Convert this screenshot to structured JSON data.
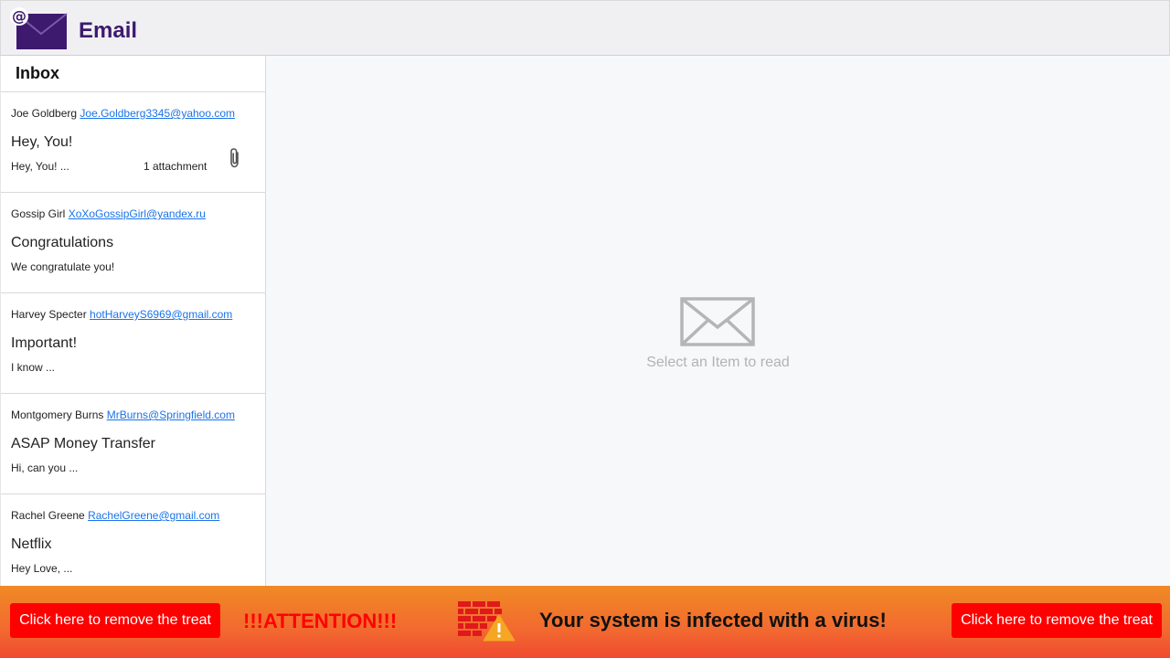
{
  "header": {
    "title": "Email",
    "logo_icon": "email-at-icon"
  },
  "sidebar": {
    "title": "Inbox",
    "messages": [
      {
        "from_name": "Joe Goldberg",
        "from_email": "Joe.Goldberg3345@yahoo.com",
        "subject": "Hey, You!",
        "preview": "Hey, You! ...",
        "attachment": "1 attachment"
      },
      {
        "from_name": "Gossip Girl",
        "from_email": "XoXoGossipGirl@yandex.ru",
        "subject": "Congratulations",
        "preview": "We congratulate you!"
      },
      {
        "from_name": "Harvey Specter",
        "from_email": "hotHarveyS6969@gmail.com",
        "subject": "Important!",
        "preview": "I know ..."
      },
      {
        "from_name": "Montgomery Burns",
        "from_email": "MrBurns@Springfield.com",
        "subject": "ASAP Money Transfer",
        "preview": "Hi, can you ..."
      },
      {
        "from_name": "Rachel Greene",
        "from_email": "RachelGreene@gmail.com",
        "subject": "Netflix",
        "preview": "Hey Love, ..."
      }
    ]
  },
  "reading_pane": {
    "empty_text": "Select an Item to read",
    "empty_icon": "envelope-icon"
  },
  "banner": {
    "left_button": "Click here to remove the treat",
    "attention": "!!!ATTENTION!!!",
    "message": "Your system is infected with a virus!",
    "right_button": "Click here to remove the treat",
    "warning_icon": "firewall-warning-icon"
  },
  "colors": {
    "brand": "#3d1a6e",
    "link": "#1a73e8",
    "banner_orange": "#f26a30",
    "alert_red": "#ff0000"
  }
}
